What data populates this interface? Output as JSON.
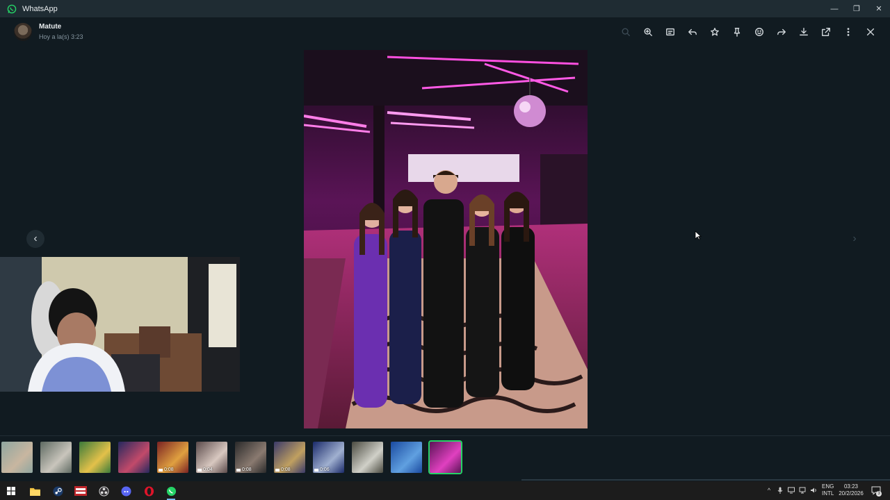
{
  "window": {
    "title": "WhatsApp",
    "controls": [
      "minimize",
      "restore",
      "close"
    ]
  },
  "header": {
    "sender": "Matute",
    "timestamp": "Hoy a la(s) 3:23"
  },
  "toolbar": [
    {
      "name": "search-icon",
      "enabled": false
    },
    {
      "name": "zoom-in-icon",
      "enabled": true
    },
    {
      "name": "caption-icon",
      "enabled": true
    },
    {
      "name": "reply-icon",
      "enabled": true
    },
    {
      "name": "star-icon",
      "enabled": true
    },
    {
      "name": "pin-icon",
      "enabled": true
    },
    {
      "name": "emoji-icon",
      "enabled": true
    },
    {
      "name": "forward-icon",
      "enabled": true
    },
    {
      "name": "download-icon",
      "enabled": true
    },
    {
      "name": "open-external-icon",
      "enabled": true
    },
    {
      "name": "more-options-icon",
      "enabled": true
    },
    {
      "name": "close-icon",
      "enabled": true
    }
  ],
  "nav": {
    "prev": "‹",
    "next": "›"
  },
  "thumbnails": [
    {
      "kind": "photo",
      "duration": ""
    },
    {
      "kind": "photo",
      "duration": ""
    },
    {
      "kind": "photo",
      "duration": ""
    },
    {
      "kind": "photo",
      "duration": ""
    },
    {
      "kind": "video",
      "duration": "0:08"
    },
    {
      "kind": "video",
      "duration": "0:04"
    },
    {
      "kind": "video",
      "duration": "0:08"
    },
    {
      "kind": "video",
      "duration": "0:08"
    },
    {
      "kind": "video",
      "duration": "0:06"
    },
    {
      "kind": "photo",
      "duration": ""
    },
    {
      "kind": "photo",
      "duration": ""
    },
    {
      "kind": "photo",
      "duration": "",
      "selected": true
    }
  ],
  "taskbar": {
    "apps": [
      "start-icon",
      "file-explorer-icon",
      "steam-icon",
      "game-app-icon",
      "obs-icon",
      "discord-icon",
      "opera-icon",
      "whatsapp-icon"
    ],
    "language": {
      "line1": "ENG",
      "line2": "INTL"
    },
    "clock": {
      "time": "03:23",
      "date": "20/2/2026"
    },
    "notifications": "3"
  },
  "colors": {
    "accent": "#25d366",
    "background": "#111b21",
    "panel": "#1f2c33"
  }
}
